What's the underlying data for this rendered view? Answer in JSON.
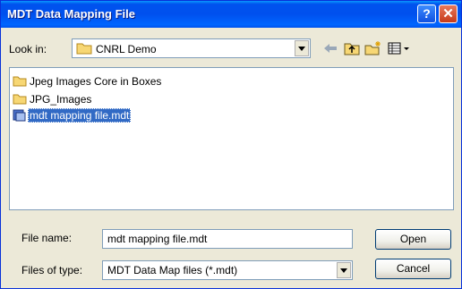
{
  "window": {
    "title": "MDT Data Mapping File",
    "help_label": "?",
    "close_label": "✕"
  },
  "toolbar": {
    "look_in_label": "Look in:",
    "look_in_value": "CNRL Demo",
    "icons": [
      "back-arrow-icon",
      "up-folder-icon",
      "new-folder-icon",
      "view-menu-icon"
    ]
  },
  "files": [
    {
      "name": "Jpeg Images Core in Boxes",
      "type": "folder",
      "selected": false
    },
    {
      "name": "JPG_Images",
      "type": "folder",
      "selected": false
    },
    {
      "name": "mdt mapping file.mdt",
      "type": "file",
      "selected": true
    }
  ],
  "form": {
    "file_name_label": "File name:",
    "file_name_value": "mdt mapping file.mdt",
    "file_type_label": "Files of type:",
    "file_type_value": "MDT Data Map files (*.mdt)",
    "open_label": "Open",
    "cancel_label": "Cancel"
  },
  "colors": {
    "titlebar": "#0053ee",
    "selection": "#316ac5",
    "dialog_bg": "#ece9d8"
  }
}
